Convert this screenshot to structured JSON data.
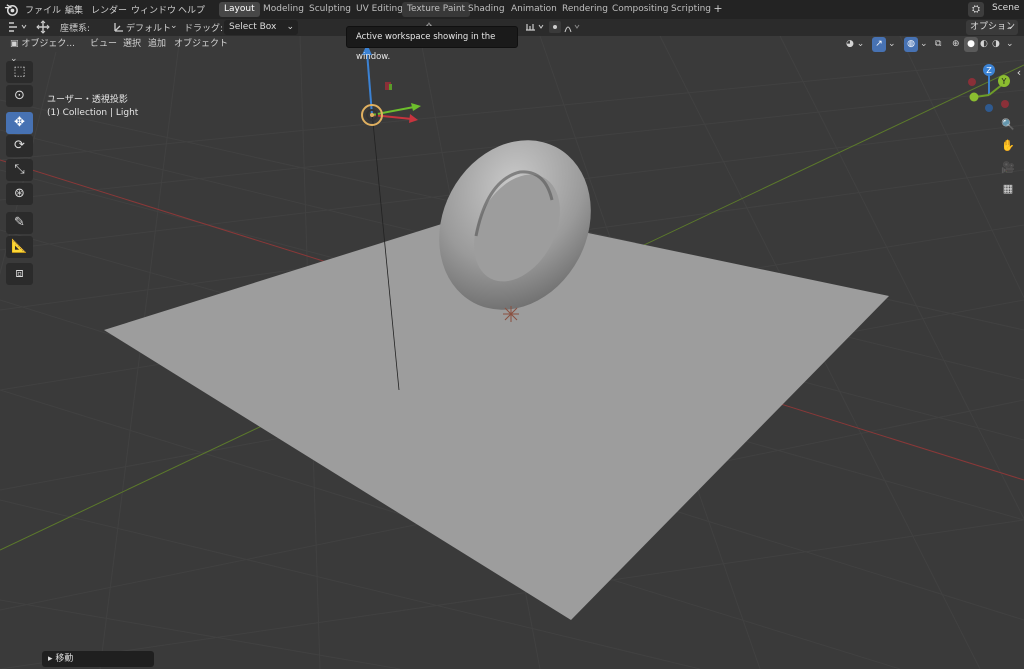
{
  "menu": {
    "items": [
      "ファイル",
      "編集",
      "レンダー",
      "ウィンドウ",
      "ヘルプ"
    ]
  },
  "workspaces": {
    "tabs": [
      "Layout",
      "Modeling",
      "Sculpting",
      "UV Editing",
      "Texture Paint",
      "Shading",
      "Animation",
      "Rendering",
      "Compositing",
      "Scripting"
    ],
    "add": "+",
    "scene": "Scene"
  },
  "header": {
    "orientation_label": "座標系:",
    "orientation_value": "デフォルト",
    "drag_label": "ドラッグ:",
    "drag_value": "Select Box",
    "options": "オプション"
  },
  "viewport": {
    "mode": "オブジェク...",
    "menu_view": "ビュー",
    "menu_select": "選択",
    "menu_add": "追加",
    "menu_object": "オブジェクト",
    "view_name": "ユーザー・透視投影",
    "collection_info": "(1) Collection | Light"
  },
  "tooltip": "Active workspace showing in the window.",
  "gizmo": {
    "x": "X",
    "y": "Y",
    "z": "Z"
  },
  "last_operator": "移動",
  "colors": {
    "accent": "#4772b3",
    "x_axis": "#c7343e",
    "y_axis": "#6e9d28",
    "z_axis": "#3b82d4"
  }
}
